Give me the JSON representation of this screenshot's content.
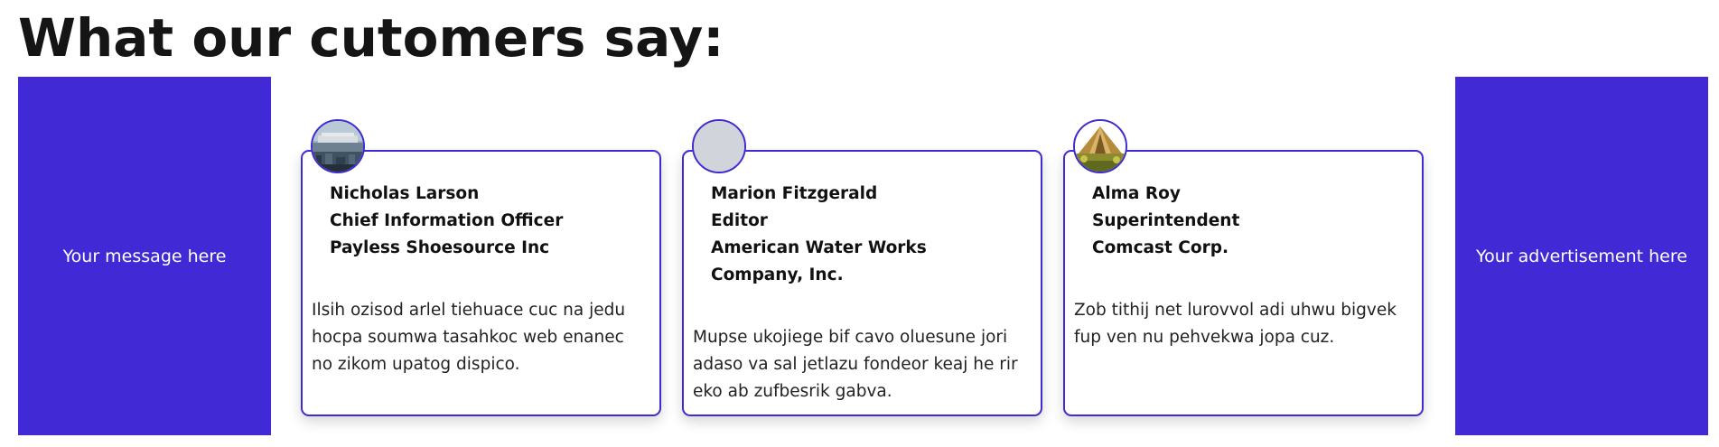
{
  "page": {
    "title": "What our cutomers say:"
  },
  "left_panel": {
    "text": "Your message here"
  },
  "right_panel": {
    "text": "Your advertisement here"
  },
  "testimonials": [
    {
      "name": "Nicholas Larson",
      "role": "Chief Information Officer",
      "company": "Payless Shoesource Inc",
      "quote": "Ilsih ozisod arlel tiehuace cuc na jedu hocpa soumwa tasahkoc web enanec no zikom upatog dispico.",
      "avatar": "photo-city-avatar"
    },
    {
      "name": "Marion Fitzgerald",
      "role": "Editor",
      "company": "American Water Works Company, Inc.",
      "quote": "Mupse ukojiege bif cavo oluesune jori adaso va sal jetlazu fondeor keaj he rir eko ab zufbesrik gabva.",
      "avatar": "placeholder-avatar"
    },
    {
      "name": "Alma Roy",
      "role": "Superintendent",
      "company": "Comcast Corp.",
      "quote": "Zob tithij net lurovvol adi uhwu bigvek fup ven nu pehvekwa jopa cuz.",
      "avatar": "photo-tent-avatar"
    }
  ],
  "colors": {
    "accent": "#4129d6",
    "card_border": "#3f2bd2",
    "title_text": "#151515",
    "avatar_placeholder": "#d1d5db"
  }
}
